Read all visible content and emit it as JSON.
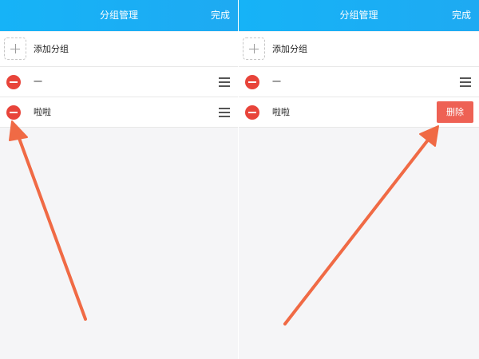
{
  "left": {
    "header": {
      "title": "分组管理",
      "done_label": "完成"
    },
    "rows": [
      {
        "label": "添加分组"
      },
      {
        "label": "一"
      },
      {
        "label": "啦啦"
      }
    ]
  },
  "right": {
    "header": {
      "title": "分组管理",
      "done_label": "完成"
    },
    "rows": [
      {
        "label": "添加分组"
      },
      {
        "label": "一"
      },
      {
        "label": "啦啦",
        "delete_label": "删除"
      }
    ]
  },
  "colors": {
    "header_bg": "#16b3f7",
    "minus_red": "#e8443a",
    "delete_bg": "#ee6154",
    "annotation_arrow": "#f06a45"
  }
}
